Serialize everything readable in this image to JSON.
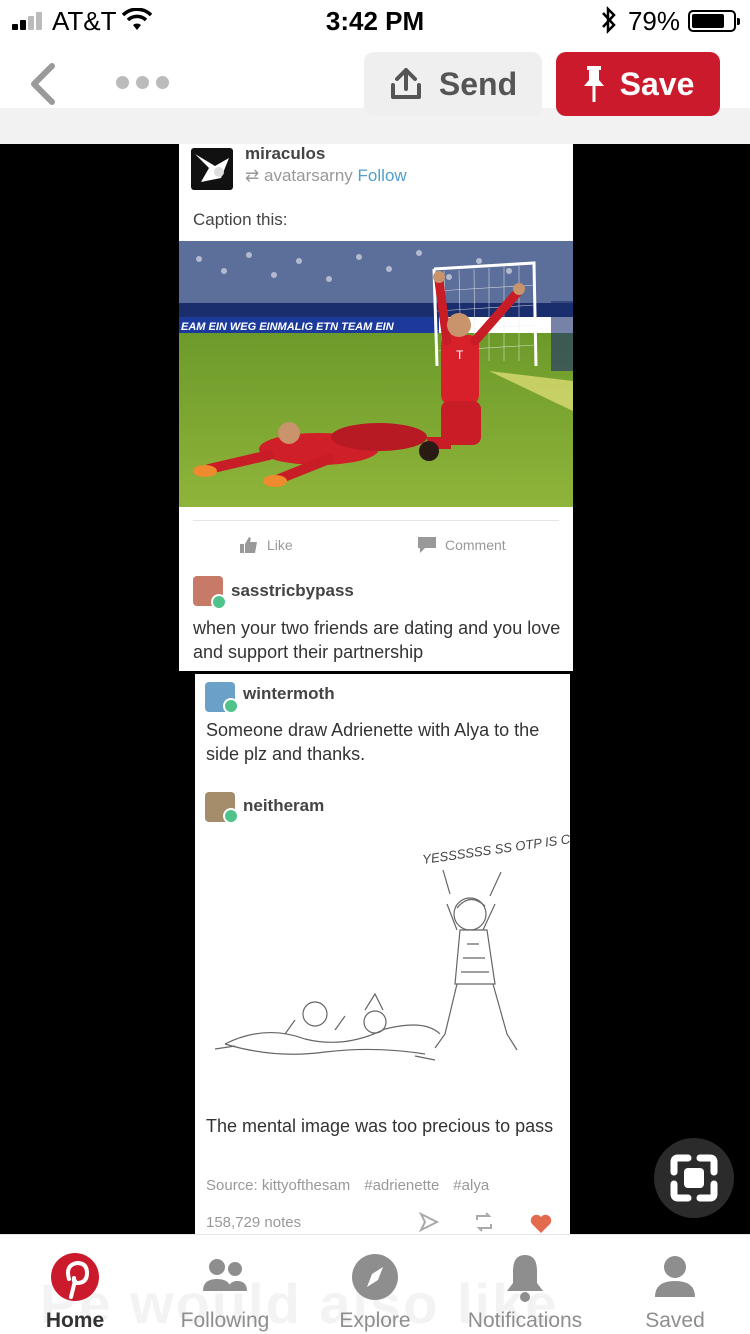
{
  "status_bar": {
    "carrier": "AT&T",
    "time": "3:42 PM",
    "battery_percent": "79%",
    "battery_level": 0.79,
    "icons": [
      "signal-icon",
      "wifi-icon",
      "bluetooth-icon",
      "battery-icon"
    ]
  },
  "toolbar": {
    "send_label": "Send",
    "save_label": "Save",
    "save_color": "#cb1a2c",
    "icons": [
      "back-chevron-icon",
      "more-dots-icon",
      "share-upload-icon",
      "pin-icon"
    ]
  },
  "pin": {
    "post1": {
      "author": "miraculos",
      "reblog_from": "avatarsarny",
      "follow_label": "Follow",
      "caption": "Caption this:",
      "photo_banner": "EAM EIN WEG EINMALIG  ETN TEAM EIN",
      "like_label": "Like",
      "comment_label": "Comment"
    },
    "reply1": {
      "author": "sasstricbypass",
      "text": "when your two friends are dating and you love and support their partnership"
    },
    "reply2": {
      "author": "wintermoth",
      "text": "Someone draw Adrienette with Alya to the side plz and thanks."
    },
    "reply3": {
      "author": "neitheram",
      "drawing_text": "YESSSSSS SS OTP IS CANON!!!",
      "text": "The mental image was too precious to pass",
      "source": "Source: kittyofthesam",
      "tags": [
        "#adrienette",
        "#alya"
      ],
      "notes": "158,729 notes"
    }
  },
  "faded_background_text": "Pe would also like",
  "tabbar": {
    "tabs": [
      {
        "label": "Home",
        "icon": "pinterest-logo-icon",
        "active": true
      },
      {
        "label": "Following",
        "icon": "people-icon",
        "active": false
      },
      {
        "label": "Explore",
        "icon": "compass-icon",
        "active": false
      },
      {
        "label": "Notifications",
        "icon": "bell-icon",
        "active": false
      },
      {
        "label": "Saved",
        "icon": "profile-icon",
        "active": false
      }
    ]
  }
}
